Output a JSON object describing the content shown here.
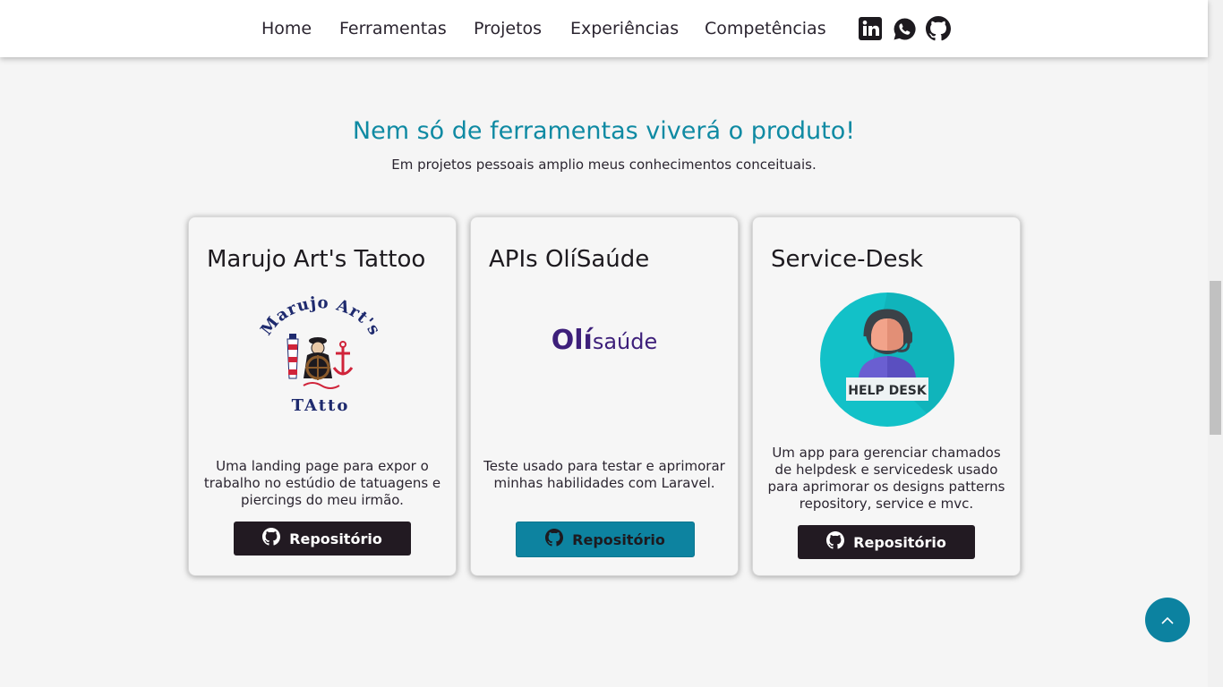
{
  "nav": {
    "links": [
      "Home",
      "Ferramentas",
      "Projetos",
      "Experiências",
      "Competências"
    ],
    "social_icons": [
      "linkedin-icon",
      "whatsapp-icon",
      "github-icon"
    ]
  },
  "section": {
    "title": "Nem só de ferramentas viverá o produto!",
    "subtitle": "Em projetos pessoais amplio meus conhecimentos conceituais."
  },
  "cards": [
    {
      "title": "Marujo Art's Tattoo",
      "logo_text_top": "Marujo Art's",
      "logo_text_bottom": "TAtto",
      "description": "Uma landing page para expor o trabalho no estúdio de tatuagens e piercings do meu irmão.",
      "button_label": "Repositório"
    },
    {
      "title": "APIs OlíSaúde",
      "logo_text_bold": "Olí",
      "logo_text_light": "saúde",
      "description": "Teste usado para testar e aprimorar minhas habilidades com Laravel.",
      "button_label": "Repositório"
    },
    {
      "title": "Service-Desk",
      "logo_text": "HELP DESK",
      "description": "Um app para gerenciar chamados de helpdesk e servicedesk usado para aprimorar os designs patterns repository, service e mvc.",
      "button_label": "Repositório"
    }
  ],
  "colors": {
    "accent": "#0f8aa3",
    "button_dark": "#221a22",
    "button_active": "#0d83a0",
    "background": "#f5f5f5"
  },
  "back_to_top_icon": "chevron-up-icon"
}
